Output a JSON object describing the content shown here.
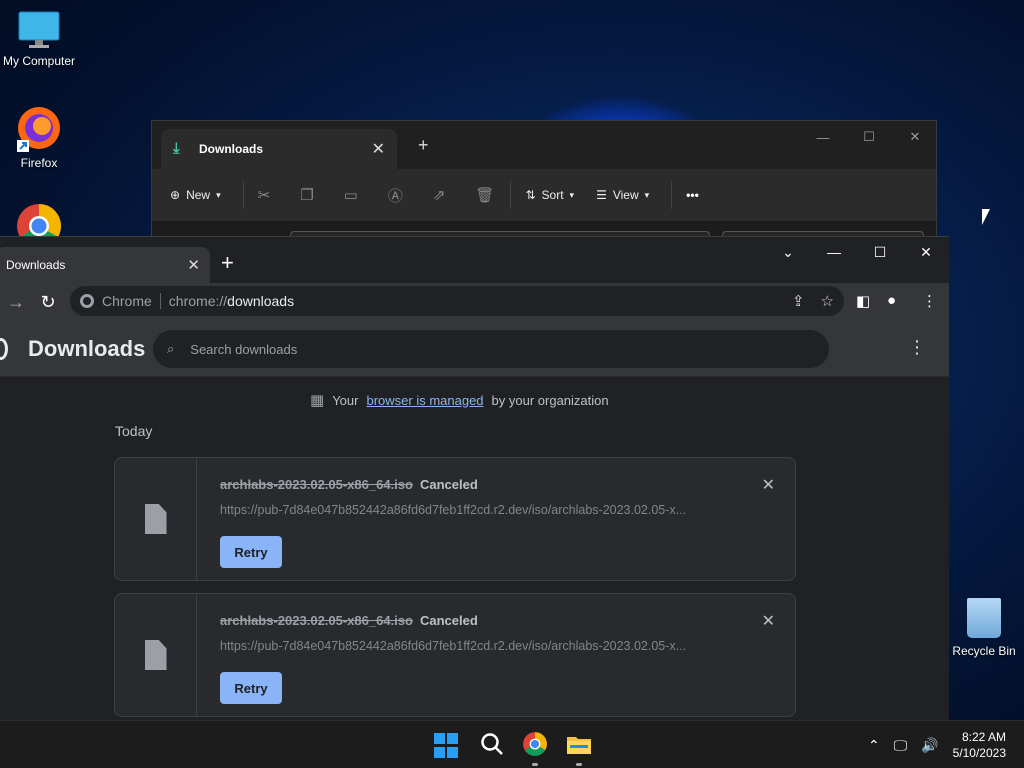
{
  "desktop": {
    "icons": [
      {
        "label": "My Computer"
      },
      {
        "label": "Firefox"
      },
      {
        "label": "Chrome"
      }
    ],
    "recycle_bin": "Recycle Bin"
  },
  "explorer": {
    "tab_title": "Downloads",
    "toolbar": {
      "new_label": "New",
      "sort_label": "Sort",
      "view_label": "View",
      "more_label": "•••"
    }
  },
  "chrome": {
    "tab_title": "Downloads",
    "omnibox": {
      "chip": "Chrome",
      "scheme": "chrome://",
      "path": "downloads"
    },
    "page": {
      "title": "Downloads",
      "search_placeholder": "Search downloads",
      "managed_prefix": "Your",
      "managed_link": "browser is managed",
      "managed_suffix": "by your organization",
      "section": "Today",
      "items": [
        {
          "filename": "archlabs-2023.02.05-x86_64.iso",
          "status": "Canceled",
          "url": "https://pub-7d84e047b852442a86fd6d7feb1ff2cd.r2.dev/iso/archlabs-2023.02.05-x...",
          "retry_label": "Retry"
        },
        {
          "filename": "archlabs-2023.02.05-x86_64.iso",
          "status": "Canceled",
          "url": "https://pub-7d84e047b852442a86fd6d7feb1ff2cd.r2.dev/iso/archlabs-2023.02.05-x...",
          "retry_label": "Retry"
        }
      ]
    }
  },
  "taskbar": {
    "time": "8:22 AM",
    "date": "5/10/2023"
  },
  "colors": {
    "accent": "#8ab4f8",
    "chrome_bg": "#202124",
    "windows_blue": "#2a9df4"
  }
}
